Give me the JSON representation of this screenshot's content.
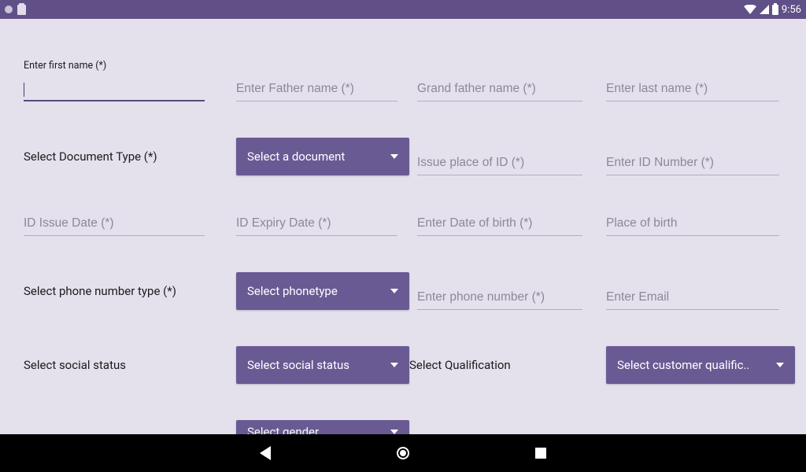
{
  "status": {
    "time": "9:56"
  },
  "row1": {
    "first_name_label": "Enter first name (*)",
    "first_name_value": "",
    "father_ph": "Enter Father name (*)",
    "grandfather_ph": "Grand father name (*)",
    "last_ph": "Enter last name (*)"
  },
  "row2": {
    "doc_label": "Select Document Type (*)",
    "doc_select": "Select a document",
    "issue_place_ph": "Issue place of ID (*)",
    "id_number_ph": "Enter ID Number (*)"
  },
  "row3": {
    "issue_date_ph": "ID Issue Date (*)",
    "expiry_ph": "ID Expiry Date (*)",
    "dob_ph": "Enter Date of birth (*)",
    "pob_ph": "Place of birth"
  },
  "row4": {
    "phone_type_label": "Select phone number type (*)",
    "phone_type_select": "Select phonetype",
    "phone_ph": "Enter phone number (*)",
    "email_ph": "Enter Email"
  },
  "row5": {
    "social_label": "Select social status",
    "social_select": "Select social status",
    "qual_label": "Select Qualification",
    "qual_select": "Select customer qualific.."
  },
  "row6": {
    "gender_select": "Select gender"
  }
}
